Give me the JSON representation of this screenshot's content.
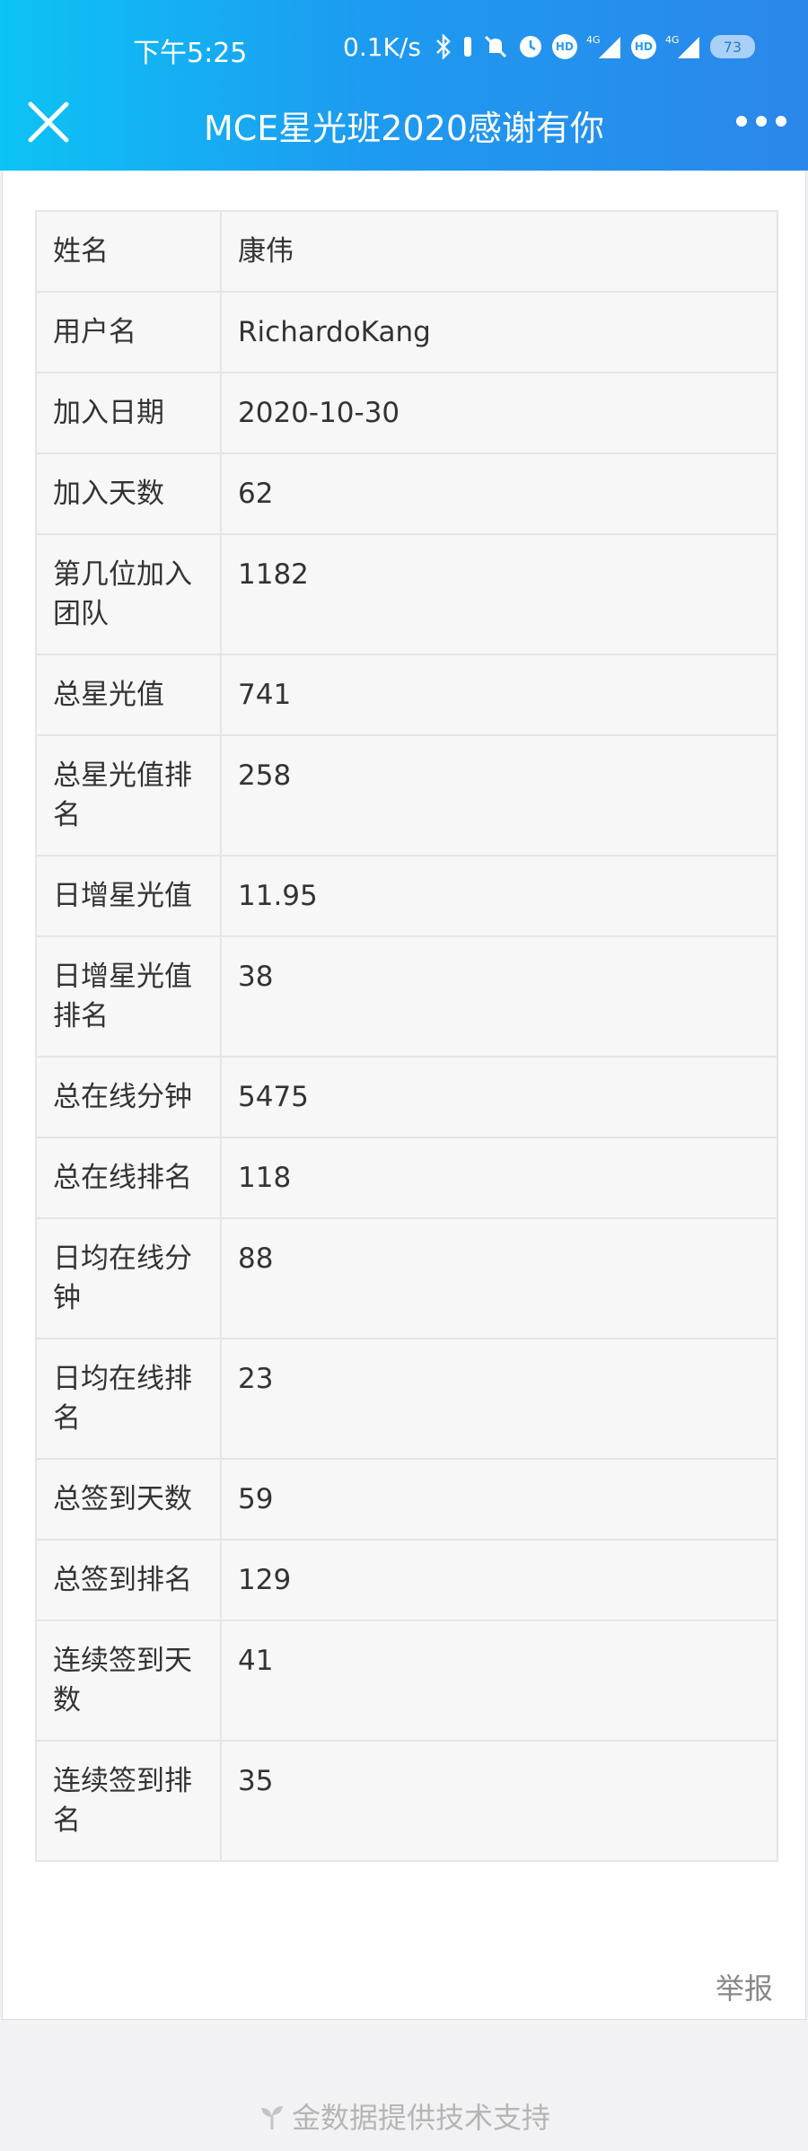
{
  "status_bar": {
    "time": "下午5:25",
    "speed": "0.1K/s",
    "hd1": "HD",
    "hd2": "HD",
    "net1": "4G",
    "net2": "4G",
    "battery": "73"
  },
  "header": {
    "title": "MCE星光班2020感谢有你",
    "close_icon": "close-icon",
    "more_icon": "more-icon"
  },
  "rows": [
    {
      "label": "姓名",
      "value": "康伟"
    },
    {
      "label": "用户名",
      "value": "RichardoKang"
    },
    {
      "label": "加入日期",
      "value": "2020-10-30"
    },
    {
      "label": "加入天数",
      "value": "62"
    },
    {
      "label": "第几位加入团队",
      "value": "1182"
    },
    {
      "label": "总星光值",
      "value": "741"
    },
    {
      "label": "总星光值排名",
      "value": "258"
    },
    {
      "label": "日增星光值",
      "value": "11.95"
    },
    {
      "label": "日增星光值排名",
      "value": "38"
    },
    {
      "label": "总在线分钟",
      "value": "5475"
    },
    {
      "label": "总在线排名",
      "value": "118"
    },
    {
      "label": "日均在线分钟",
      "value": "88"
    },
    {
      "label": "日均在线排名",
      "value": "23"
    },
    {
      "label": "总签到天数",
      "value": "59"
    },
    {
      "label": "总签到排名",
      "value": "129"
    },
    {
      "label": "连续签到天数",
      "value": "41"
    },
    {
      "label": "连续签到排名",
      "value": "35"
    }
  ],
  "report_label": "举报",
  "footer_text": "金数据提供技术支持",
  "colors": {
    "header_start": "#0cc3f5",
    "header_end": "#2b87ea",
    "table_bg": "#f7f7f7",
    "footer_text": "#b5b5b5"
  }
}
